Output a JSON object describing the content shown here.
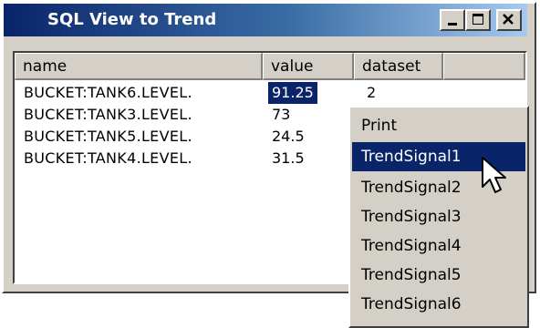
{
  "window": {
    "title": "SQL View to Trend",
    "minimize_glyph": "_",
    "maximize_glyph": "□",
    "close_glyph": "✕"
  },
  "grid": {
    "columns": [
      "name",
      "value",
      "dataset",
      ""
    ],
    "rows": [
      {
        "name": "BUCKET:TANK6.LEVEL.",
        "value": "91.25",
        "dataset": "2"
      },
      {
        "name": "BUCKET:TANK3.LEVEL.",
        "value": "73",
        "dataset": ""
      },
      {
        "name": "BUCKET:TANK5.LEVEL.",
        "value": "24.5",
        "dataset": ""
      },
      {
        "name": "BUCKET:TANK4.LEVEL.",
        "value": "31.5",
        "dataset": ""
      }
    ],
    "selected_cell": "value-row-1"
  },
  "context_menu": {
    "items": [
      "Print",
      "TrendSignal1",
      "TrendSignal2",
      "TrendSignal3",
      "TrendSignal4",
      "TrendSignal5",
      "TrendSignal6"
    ],
    "highlighted_item": "TrendSignal1"
  },
  "colors": {
    "titlebar_start": "#0a246a",
    "titlebar_end": "#a6caf0",
    "selection": "#0a246a",
    "face": "#d4d0c8"
  },
  "icons": {
    "cursor": "arrow-pointer-icon"
  }
}
